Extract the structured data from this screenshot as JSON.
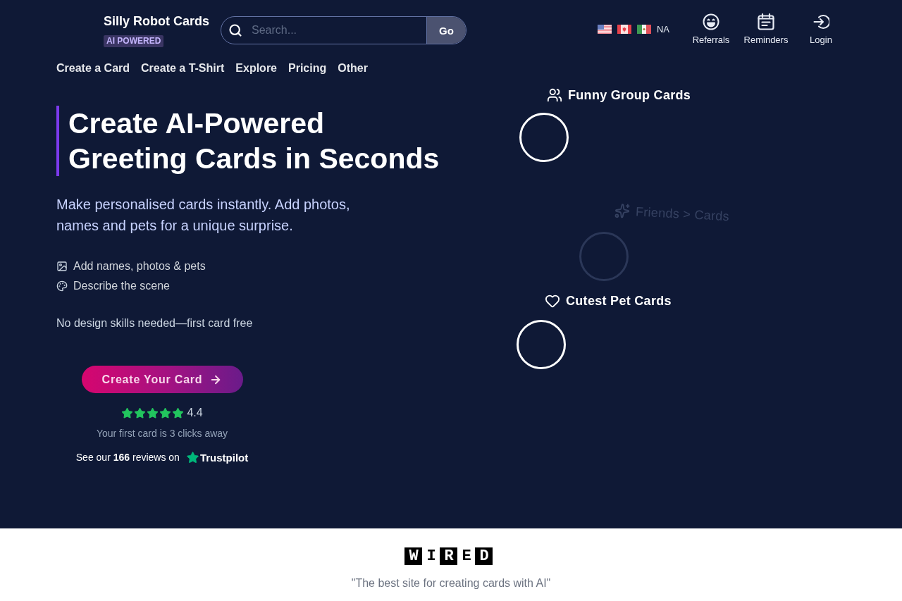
{
  "header": {
    "brand": "Silly Robot Cards",
    "badge": "AI POWERED",
    "search": {
      "placeholder": "Search...",
      "button": "Go"
    },
    "region": "NA",
    "actions": [
      {
        "label": "Referrals"
      },
      {
        "label": "Reminders"
      },
      {
        "label": "Login"
      }
    ]
  },
  "nav": [
    "Create a Card",
    "Create a T-Shirt",
    "Explore",
    "Pricing",
    "Other"
  ],
  "hero": {
    "title_lines": [
      "Create AI-Powered",
      "Greeting Cards in Seconds"
    ],
    "subtitle_lines": [
      "Make personalised cards instantly. Add photos,",
      "names and pets for a unique surprise."
    ],
    "features": [
      "Add names, photos & pets",
      "Describe the scene"
    ],
    "note": "No design skills needed—first card free",
    "cta": "Create Your Card",
    "rating": {
      "stars": 5,
      "score": "4.4"
    },
    "tagline": "Your first card is 3 clicks away",
    "reviews": {
      "text": "See our **166** reviews on",
      "site": "Trustpilot"
    }
  },
  "showcase": {
    "slides": [
      {
        "title": "Funny Group Cards",
        "faded": false
      },
      {
        "title": "Friends > Cards",
        "faded": true
      },
      {
        "title": "Cutest Pet Cards",
        "faded": false
      }
    ]
  },
  "press": {
    "logo": "WIRED",
    "quote": "\"The best site for creating cards with AI\""
  }
}
